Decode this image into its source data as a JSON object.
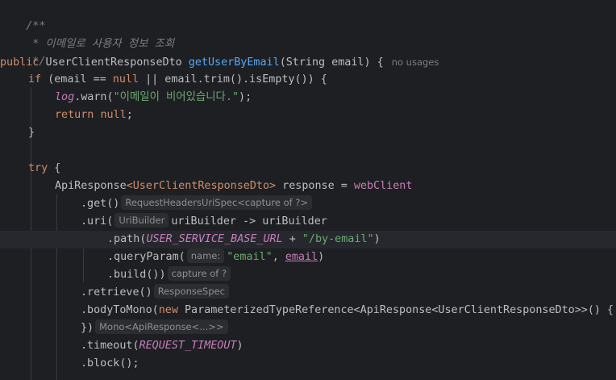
{
  "editor": {
    "comment_open": "/**",
    "comment_body": " * 이메일로 사용자 정보 조회",
    "comment_close": " */",
    "usages": "no usages",
    "t_public": "public",
    "t_return_type": "UserClientResponseDto",
    "t_method": "getUserByEmail",
    "t_params": "(String email) {",
    "t_if": "if",
    "t_cond_a": " (email == ",
    "t_null": "null",
    "t_cond_b": " || email.trim().isEmpty()) {",
    "t_log": "log",
    "t_warn_a": ".warn(",
    "t_warn_str": "\"이메일이 비어있습니다.\"",
    "t_warn_b": ");",
    "t_return": "return",
    "t_semi": ";",
    "t_close": "}",
    "t_try": "try",
    "t_brace": " {",
    "t_decl_a": "ApiResponse",
    "t_decl_gen": "<UserClientResponseDto>",
    "t_decl_b": " response = ",
    "t_webclient": "webClient",
    "t_get": ".get()",
    "hint_get": "RequestHeadersUriSpec<capture of ?>",
    "t_uri_a": ".uri(",
    "hint_uri": "UriBuilder",
    "t_uri_b": "uriBuilder -> uriBuilder",
    "t_path_a": ".path(",
    "t_base_url": "USER_SERVICE_BASE_URL",
    "t_plus": " + ",
    "t_path_str": "\"/by-email\"",
    "t_paren": ")",
    "t_qp_a": ".queryParam(",
    "hint_name": "name:",
    "t_qp_str": "\"email\"",
    "t_comma": ", ",
    "t_email": "email",
    "t_build": ".build())",
    "hint_build": "capture of ?",
    "t_retrieve": ".retrieve()",
    "hint_retrieve": "ResponseSpec",
    "t_body_a": ".bodyToMono(",
    "t_new": "new",
    "t_body_b": " ParameterizedTypeReference<ApiResponse<UserClientResponseDto>>() {",
    "t_close_paren": "})",
    "hint_mono": "Mono<ApiResponse<...>>",
    "t_timeout_a": ".timeout(",
    "t_timeout_const": "REQUEST_TIMEOUT",
    "t_block": ".block();"
  }
}
